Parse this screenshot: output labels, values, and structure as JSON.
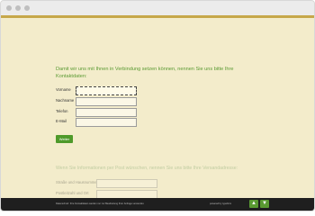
{
  "heading": "Damit wir uns mit Ihnen in Verbindung setzen können, nennen Sie uns bitte Ihre Kontaktdaten:",
  "fields": [
    {
      "label": "Vorname",
      "value": ""
    },
    {
      "label": "Nachname",
      "value": ""
    },
    {
      "label": "Telefon",
      "value": ""
    },
    {
      "label": "E-Mail",
      "value": ""
    }
  ],
  "button_label": "Weiter",
  "next_section": {
    "heading": "Wenn Sie Informationen per Post wünschen, nennen Sie uns bitte Ihre Versandadresse:",
    "fields": [
      {
        "label": "Straße und Hausnummer",
        "value": ""
      },
      {
        "label": "Postleitzahl und Ort",
        "value": ""
      }
    ]
  },
  "footer": {
    "left_text": "Datenschutz: Ihre Kontaktdaten werden nur zur Bearbeitung Ihrer Anfrage verwendet.",
    "right_text": "powered by typeform",
    "nav_up": "▲",
    "nav_down": "▼"
  },
  "colors": {
    "background": "#f3eccb",
    "accent": "#c6a84a",
    "heading": "#5a9a32",
    "button": "#4e9a2a",
    "footer": "#1f1f1f"
  }
}
